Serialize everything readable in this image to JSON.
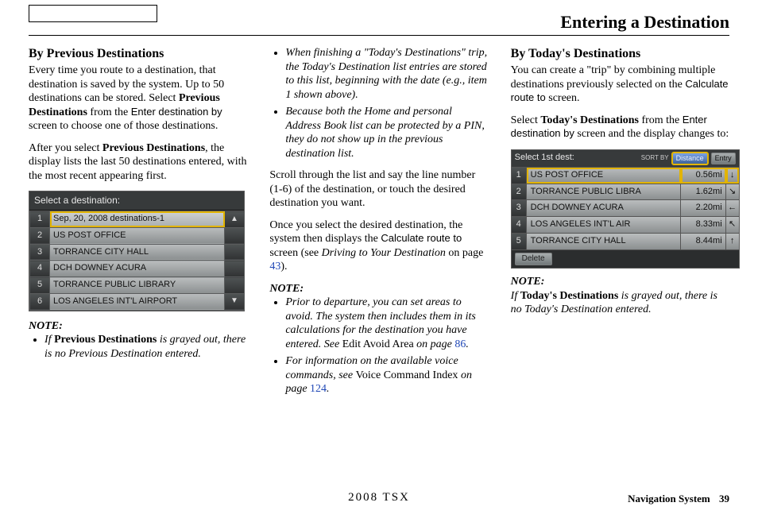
{
  "page": {
    "title": "Entering a Destination",
    "model_footer": "2008  TSX",
    "footer_label": "Navigation System",
    "page_number": "39"
  },
  "col1": {
    "heading": "By Previous Destinations",
    "p1_a": "Every time you route to a destination, that destination is saved by the system. Up to 50 destinations can be stored. Select ",
    "p1_b": "Previous Destinations",
    "p1_c": " from the ",
    "p1_d": "Enter destination by",
    "p1_e": " screen to choose one of those destinations.",
    "p2_a": "After you select ",
    "p2_b": "Previous Destinations",
    "p2_c": ", the display lists the last 50 destinations entered, with the most recent appearing first.",
    "screen_title": "Select a destination:",
    "rows": [
      {
        "n": "1",
        "label": "Sep, 20, 2008 destinations-1"
      },
      {
        "n": "2",
        "label": "US POST OFFICE"
      },
      {
        "n": "3",
        "label": "TORRANCE CITY HALL"
      },
      {
        "n": "4",
        "label": "DCH DOWNEY ACURA"
      },
      {
        "n": "5",
        "label": "TORRANCE PUBLIC LIBRARY"
      },
      {
        "n": "6",
        "label": "LOS ANGELES INT'L AIRPORT"
      }
    ],
    "side_up": "▲",
    "side_down": "▼",
    "note_label": "NOTE:",
    "note1_a": "If ",
    "note1_b": "Previous Destinations",
    "note1_c": " is grayed out, there is no Previous Destination entered."
  },
  "col2": {
    "note1": "When finishing a \"Today's Destinations\" trip, the Today's Destination list entries are stored to this list, beginning with the date (e.g., item 1 shown above).",
    "note2": "Because both the Home and personal Address Book list can be protected by a PIN, they do not show up in the previous destination list.",
    "p1": "Scroll through the list and say the line number (1-6) of the destination, or touch the desired destination you want.",
    "p2_a": "Once you select the desired destination, the system then displays the ",
    "p2_b": "Calculate route to",
    "p2_c": " screen (see ",
    "p2_d": "Driving to Your Destination",
    "p2_e": " on page ",
    "p2_f": "43",
    "p2_g": ").",
    "note_label": "NOTE:",
    "n3_a": "Prior to departure, you can set areas to avoid. The system then includes them in its calculations for the destination you have entered. See ",
    "n3_b": "Edit Avoid Area",
    "n3_c": " on page ",
    "n3_d": "86",
    "n3_e": ".",
    "n4_a": "For information on the available voice commands, see ",
    "n4_b": "Voice Command Index",
    "n4_c": " on page ",
    "n4_d": "124",
    "n4_e": "."
  },
  "col3": {
    "heading": "By Today's Destinations",
    "p1_a": "You can create a \"trip\" by combining multiple destinations previously selected on the ",
    "p1_b": "Calculate route to",
    "p1_c": " screen.",
    "p2_a": "Select ",
    "p2_b": "Today's Destinations",
    "p2_c": " from the ",
    "p2_d": "Enter destination by",
    "p2_e": " screen and the display changes to:",
    "screen_title": "Select 1st dest:",
    "sort_label": "SORT BY",
    "sort_distance": "Distance",
    "sort_entry": "Entry",
    "rows": [
      {
        "n": "1",
        "label": "US POST OFFICE",
        "dist": "0.56mi",
        "dir": "↓"
      },
      {
        "n": "2",
        "label": "TORRANCE PUBLIC LIBRA",
        "dist": "1.62mi",
        "dir": "↘"
      },
      {
        "n": "3",
        "label": "DCH DOWNEY ACURA",
        "dist": "2.20mi",
        "dir": "←"
      },
      {
        "n": "4",
        "label": "LOS ANGELES INT'L AIR",
        "dist": "8.33mi",
        "dir": "↖"
      },
      {
        "n": "5",
        "label": "TORRANCE CITY HALL",
        "dist": "8.44mi",
        "dir": "↑"
      }
    ],
    "delete_label": "Delete",
    "note_label": "NOTE:",
    "note_a": "If ",
    "note_b": "Today's Destinations",
    "note_c": " is grayed out, there is no Today's Destination entered."
  }
}
